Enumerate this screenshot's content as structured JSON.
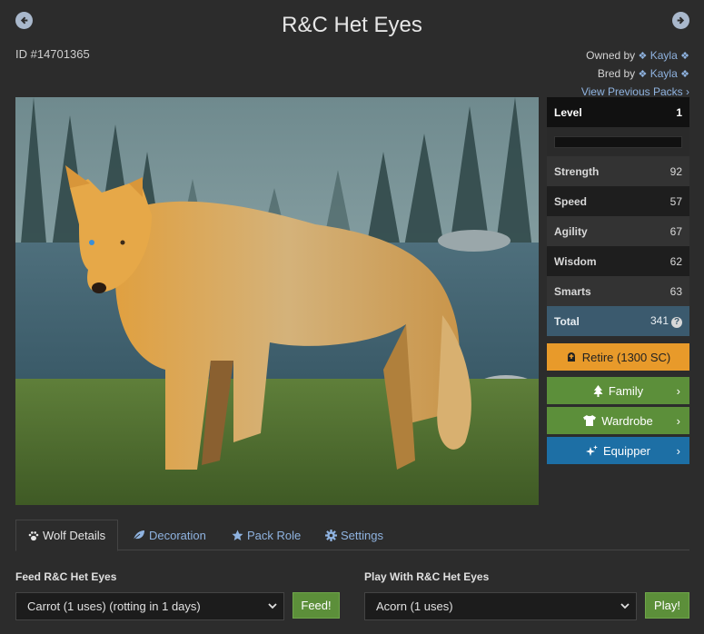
{
  "header": {
    "title": "R&C Het Eyes",
    "id_text": "ID #14701365",
    "owned_by_prefix": "Owned by",
    "owner_name": "Kayla",
    "bred_by_prefix": "Bred by",
    "breeder_name": "Kayla",
    "previous_packs_link": "View Previous Packs"
  },
  "stats": {
    "level_label": "Level",
    "level_value": "1",
    "experience_progress": 0,
    "rows": [
      {
        "label": "Strength",
        "value": "92"
      },
      {
        "label": "Speed",
        "value": "57"
      },
      {
        "label": "Agility",
        "value": "67"
      },
      {
        "label": "Wisdom",
        "value": "62"
      },
      {
        "label": "Smarts",
        "value": "63"
      }
    ],
    "total_label": "Total",
    "total_value": "341"
  },
  "actions": {
    "retire_label": "Retire (1300 SC)",
    "family_label": "Family",
    "wardrobe_label": "Wardrobe",
    "equipper_label": "Equipper"
  },
  "tabs": [
    {
      "label": "Wolf Details",
      "active": true
    },
    {
      "label": "Decoration",
      "active": false
    },
    {
      "label": "Pack Role",
      "active": false
    },
    {
      "label": "Settings",
      "active": false
    }
  ],
  "feed": {
    "label": "Feed R&C Het Eyes",
    "selected": "Carrot (1 uses) (rotting in 1 days)",
    "button": "Feed!"
  },
  "play": {
    "label": "Play With R&C Het Eyes",
    "selected": "Acorn (1 uses)",
    "button": "Play!"
  },
  "icons": {
    "prev": "arrow-left-circle-icon",
    "next": "arrow-right-circle-icon",
    "retire": "tombstone-icon",
    "family": "tree-icon",
    "wardrobe": "shirt-icon",
    "equipper": "sparkle-icon",
    "wolf_details": "paw-icon",
    "decoration": "leaf-icon",
    "pack_role": "star-icon",
    "settings": "gear-icon"
  },
  "colors": {
    "retire": "#e89a2a",
    "green_button": "#5c8f3a",
    "equipper": "#1d6fa5",
    "total_row": "#3b5a6e",
    "link": "#8fb3e0"
  }
}
